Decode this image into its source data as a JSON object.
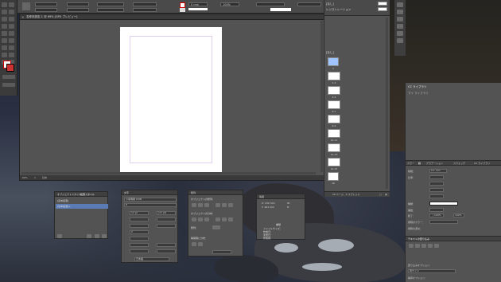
{
  "doc": {
    "tab_title": "名称未設定-1 @ 69% [GPU プレビュー]",
    "status_zoom": "69%",
    "status_page": "1",
    "status_mode": "基本"
  },
  "control_bar": {
    "stroke_value": "0 mm",
    "percent": "100%"
  },
  "swatches": {
    "rows": [
      "[なし]",
      "レジストレーション"
    ]
  },
  "pages_panel": {
    "header": "[なし]",
    "thumbs": [
      "1",
      "2-3",
      "4-5",
      "6-7",
      "8-9",
      "10-11",
      "12-13",
      "14-15",
      "16"
    ],
    "footer": "16 ページ、9 スプレッド"
  },
  "right_dock": {
    "cc_libraries": "CC ライブラリ",
    "library_name": "マイ ライブラリ",
    "stroke_tabs": [
      "カラー",
      "線",
      "グラデーション",
      "スウォッチ",
      "CC ライブラリ"
    ],
    "stroke_label": "線幅：",
    "stroke_weight": "0.1 mm",
    "miter": "比率：",
    "stroke_type": "種類：",
    "start": "開始：",
    "end": "終了：",
    "gap_color": "間隔のカラー：",
    "gap_tint": "間隔の濃淡：",
    "scale1": "100%",
    "scale2": "100%",
    "text_wrap_title": "テキストの回り込み",
    "wrap_options": "回り込みオプション：",
    "contour_options": "輪郭オプション：",
    "wrap_to": "両サイド"
  },
  "object_styles": {
    "tabs": [
      "オブジェクトスタイル",
      "段落スタイル"
    ],
    "rows": [
      "[基本段落]",
      "[基本段落]+"
    ]
  },
  "char_panel": {
    "tab": "文字",
    "font": "小塚明朝 Pr6N",
    "style": "R",
    "size": "12 pt",
    "leading": "(21 pt)",
    "tracking": "0",
    "language": "日本語"
  },
  "align_panel": {
    "tab": "整列",
    "align_objects": "オブジェクトの整列：",
    "distribute": "オブジェクトの分布：",
    "distribute_spacing": "等間隔に分布：",
    "align_to": "整列："
  },
  "info_panel": {
    "tab": "情報",
    "x": "X: 132 mm",
    "y": "Y: 101 mm",
    "w": "W:",
    "h": "H:",
    "doc_label": "書類",
    "rows": [
      "ファイルサイズ：",
      "作成日：",
      "変更日：",
      "作成者："
    ]
  }
}
